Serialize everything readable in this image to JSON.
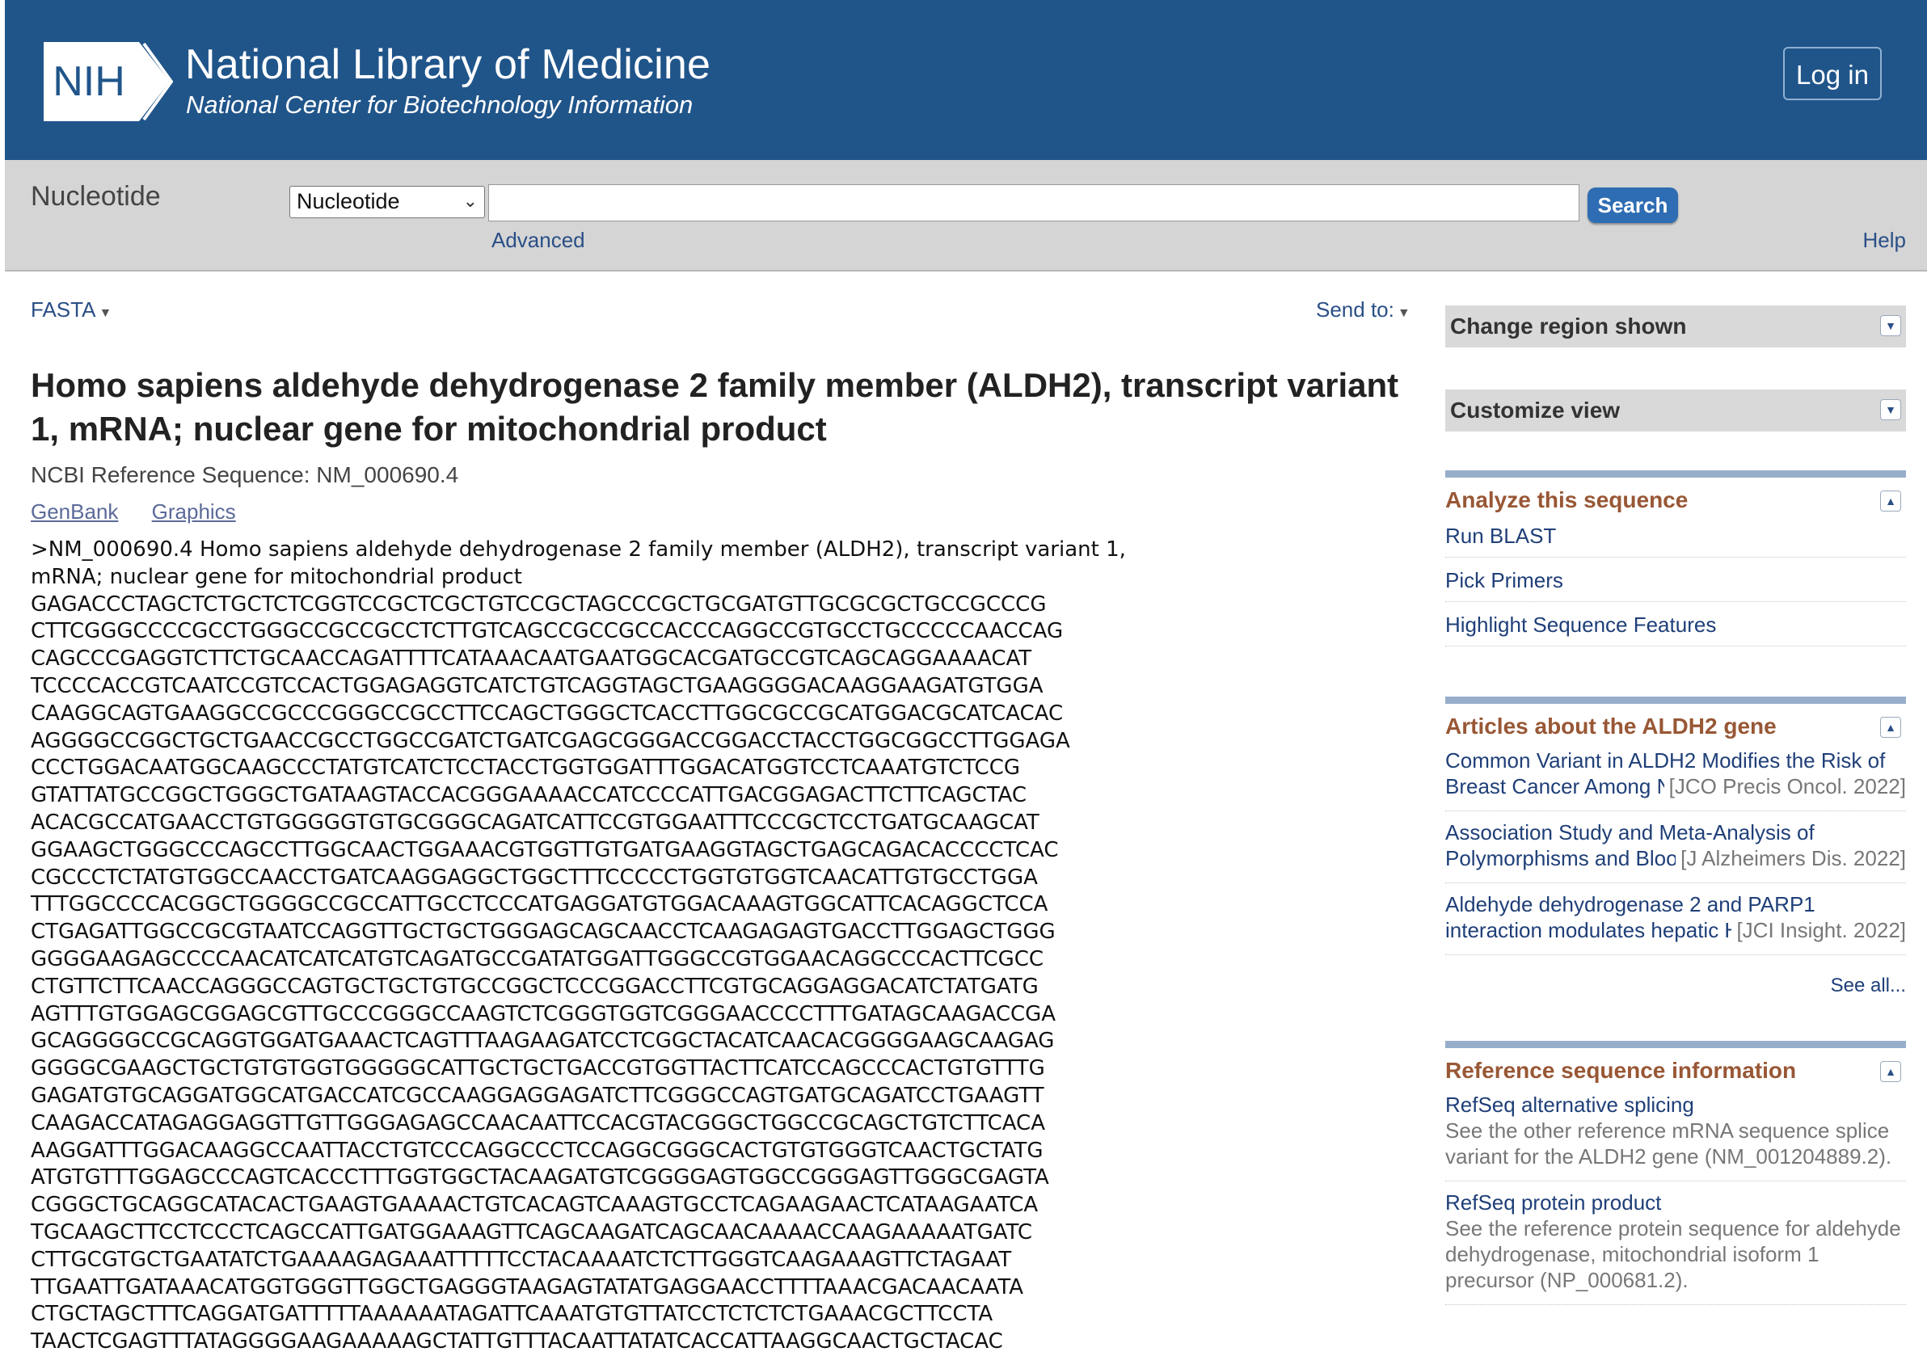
{
  "header": {
    "logo_text": "NIH",
    "title": "National Library of Medicine",
    "subtitle": "National Center for Biotechnology Information",
    "login_label": "Log in",
    "bg_color": "#20558a"
  },
  "search": {
    "db_title": "Nucleotide",
    "db_selected": "Nucleotide",
    "query": "",
    "button_label": "Search",
    "advanced_label": "Advanced",
    "help_label": "Help"
  },
  "toolbar": {
    "format_label": "FASTA",
    "send_to_label": "Send to:"
  },
  "record": {
    "title": "Homo sapiens aldehyde dehydrogenase 2 family member (ALDH2), transcript variant 1, mRNA; nuclear gene for mitochondrial product",
    "reference_label": "NCBI Reference Sequence: NM_000690.4",
    "views": [
      "GenBank",
      "Graphics"
    ],
    "fasta_lines": [
      ">NM_000690.4 Homo sapiens aldehyde dehydrogenase 2 family member (ALDH2), transcript variant 1,",
      "mRNA; nuclear gene for mitochondrial product",
      "GAGACCCTAGCTCTGCTCTCGGTCCGCTCGCTGTCCGCTAGCCCGCTGCGATGTTGCGCGCTGCCGCCCG",
      "CTTCGGGCCCCGCCTGGGCCGCCGCCTCTTGTCAGCCGCCGCCACCCAGGCCGTGCCTGCCCCCAACCAG",
      "CAGCCCGAGGTCTTCTGCAACCAGATTTTCATAAACAATGAATGGCACGATGCCGTCAGCAGGAAAACAT",
      "TCCCCACCGTCAATCCGTCCACTGGAGAGGTCATCTGTCAGGTAGCTGAAGGGGACAAGGAAGATGTGGA",
      "CAAGGCAGTGAAGGCCGCCCGGGCCGCCTTCCAGCTGGGCTCACCTTGGCGCCGCATGGACGCATCACAC",
      "AGGGGCCGGCTGCTGAACCGCCTGGCCGATCTGATCGAGCGGGACCGGACCTACCTGGCGGCCTTGGAGA",
      "CCCTGGACAATGGCAAGCCCTATGTCATCTCCTACCTGGTGGATTTGGACATGGTCCTCAAATGTCTCCG",
      "GTATTATGCCGGCTGGGCTGATAAGTACCACGGGAAAACCATCCCCATTGACGGAGACTTCTTCAGCTAC",
      "ACACGCCATGAACCTGTGGGGGTGTGCGGGCAGATCATTCCGTGGAATTTCCCGCTCCTGATGCAAGCAT",
      "GGAAGCTGGGCCCAGCCTTGGCAACTGGAAACGTGGTTGTGATGAAGGTAGCTGAGCAGACACCCCTCAC",
      "CGCCCTCTATGTGGCCAACCTGATCAAGGAGGCTGGCTTTCCCCCTGGTGTGGTCAACATTGTGCCTGGA",
      "TTTGGCCCCACGGCTGGGGCCGCCATTGCCTCCCATGAGGATGTGGACAAAGTGGCATTCACAGGCTCCA",
      "CTGAGATTGGCCGCGTAATCCAGGTTGCTGCTGGGAGCAGCAACCTCAAGAGAGTGACCTTGGAGCTGGG",
      "GGGGAAGAGCCCCAACATCATCATGTCAGATGCCGATATGGATTGGGCCGTGGAACAGGCCCACTTCGCC",
      "CTGTTCTTCAACCAGGGCCAGTGCTGCTGTGCCGGCTCCCGGACCTTCGTGCAGGAGGACATCTATGATG",
      "AGTTTGTGGAGCGGAGCGTTGCCCGGGCCAAGTCTCGGGTGGTCGGGAACCCCTTTGATAGCAAGACCGA",
      "GCAGGGGCCGCAGGTGGATGAAACTCAGTTTAAGAAGATCCTCGGCTACATCAACACGGGGAAGCAAGAG",
      "GGGGCGAAGCTGCTGTGTGGTGGGGGCATTGCTGCTGACCGTGGTTACTTCATCCAGCCCACTGTGTTTG",
      "GAGATGTGCAGGATGGCATGACCATCGCCAAGGAGGAGATCTTCGGGCCAGTGATGCAGATCCTGAAGTT",
      "CAAGACCATAGAGGAGGTTGTTGGGAGAGCCAACAATTCCACGTACGGGCTGGCCGCAGCTGTCTTCACA",
      "AAGGATTTGGACAAGGCCAATTACCTGTCCCAGGCCCTCCAGGCGGGCACTGTGTGGGTCAACTGCTATG",
      "ATGTGTTTGGAGCCCAGTCACCCTTTGGTGGCTACAAGATGTCGGGGAGTGGCCGGGAGTTGGGCGAGTA",
      "CGGGCTGCAGGCATACACTGAAGTGAAAACTGTCACAGTCAAAGTGCCTCAGAAGAACTCATAAGAATCA",
      "TGCAAGCTTCCTCCCTCAGCCATTGATGGAAAGTTCAGCAAGATCAGCAACAAAACCAAGAAAAATGATC",
      "CTTGCGTGCTGAATATCTGAAAAGAGAAATTTTTCCTACAAAATCTCTTGGGTCAAGAAAGTTCTAGAAT",
      "TTGAATTGATAAACATGGTGGGTTGGCTGAGGGTAAGAGTATATGAGGAACCTTTTAAACGACAACAATA",
      "CTGCTAGCTTTCAGGATGATTTTTAAAAAATAGATTCAAATGTGTTATCCTCTCTCTGAAACGCTTCCTA",
      "TAACTCGAGTTTATAGGGGAAGAAAAAGCTATTGTTTACAATTATATCACCATTAAGGCAACTGCTACAC"
    ]
  },
  "sidebar": {
    "change_region": "Change region shown",
    "customize_view": "Customize view",
    "analyze": {
      "title": "Analyze this sequence",
      "links": [
        "Run BLAST",
        "Pick Primers",
        "Highlight Sequence Features"
      ]
    },
    "articles": {
      "title": "Articles about the ALDH2 gene",
      "items": [
        {
          "line1": "Common Variant in ALDH2 Modifies the Risk of",
          "line2": "Breast Cancer Among Never-Smokers",
          "journal": "[JCO Precis Oncol. 2022]"
        },
        {
          "line1": "Association Study and Meta-Analysis of",
          "line2": "Polymorphisms and Blood Mineral Levels",
          "journal": "[J Alzheimers Dis. 2022]"
        },
        {
          "line1": "Aldehyde dehydrogenase 2 and PARP1",
          "line2": "interaction modulates hepatic HDL",
          "journal": "[JCI Insight. 2022]"
        }
      ],
      "see_all": "See all..."
    },
    "refseq_info": {
      "title": "Reference sequence information",
      "items": [
        {
          "link": "RefSeq alternative splicing",
          "desc": "See the other reference mRNA sequence splice variant for the ALDH2 gene (NM_001204889.2)."
        },
        {
          "link": "RefSeq protein product",
          "desc": "See the reference protein sequence for aldehyde dehydrogenase, mitochondrial isoform 1 precursor (NP_000681.2)."
        }
      ]
    },
    "accent_color": "#985735"
  }
}
